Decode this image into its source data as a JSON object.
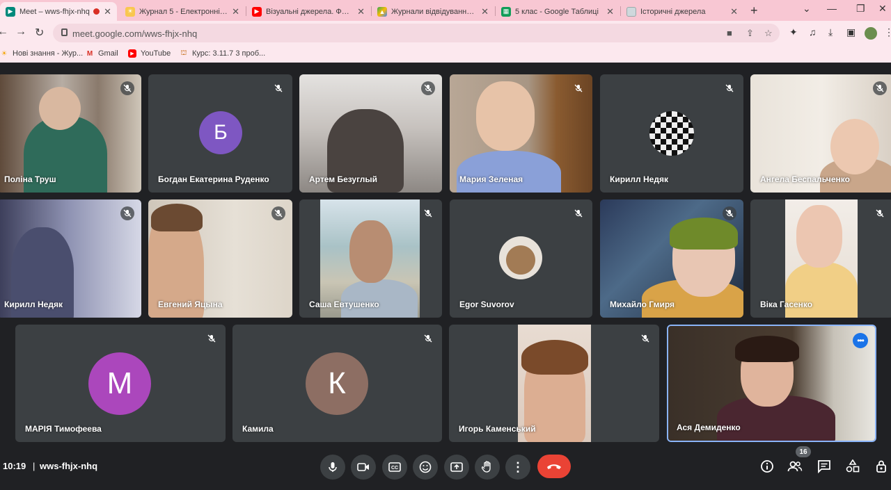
{
  "browser": {
    "tabs": [
      {
        "title": "Meet – wws-fhjx-nhq",
        "active": true
      },
      {
        "title": "Журнал 5 - Електронні щ"
      },
      {
        "title": "Візуальні джерела. Фото-"
      },
      {
        "title": "Журнали відвідування – С"
      },
      {
        "title": "5 клас - Google Таблиці"
      },
      {
        "title": "Історичні джерела"
      }
    ],
    "url": "meet.google.com/wws-fhjx-nhq",
    "bookmarks": [
      {
        "label": "Нові знання - Жур..."
      },
      {
        "label": "Gmail"
      },
      {
        "label": "YouTube"
      },
      {
        "label": "Курс: 3.11.7 3 проб..."
      }
    ]
  },
  "meet": {
    "participants": [
      {
        "name": "Поліна Труш"
      },
      {
        "name": "Богдан Екатерина Руденко",
        "initial": "Б"
      },
      {
        "name": "Артем Безуглый"
      },
      {
        "name": "Мария Зеленая"
      },
      {
        "name": "Кирилл Недяк"
      },
      {
        "name": "Ангела Беспальченко"
      },
      {
        "name": "Кирилл Недяк"
      },
      {
        "name": "Евгений Яцына"
      },
      {
        "name": "Саша Евтушенко"
      },
      {
        "name": "Egor Suvorov"
      },
      {
        "name": "Михайло Гмиря"
      },
      {
        "name": "Віка Гасенко"
      },
      {
        "name": "МАРІЯ Тимофеева",
        "initial": "М"
      },
      {
        "name": "Камила",
        "initial": "К"
      },
      {
        "name": "Игорь Каменський"
      },
      {
        "name": "Ася Демиденко"
      }
    ],
    "time": "10:19",
    "meeting_code": "wws-fhjx-nhq",
    "participant_count": "16"
  },
  "colors": {
    "accent": "#1a73e8",
    "hangup": "#ea4335",
    "tile_bg": "#3c4043",
    "avatar_purple_b": "#7e57c2",
    "avatar_purple_m": "#ab47bc",
    "avatar_brown_k": "#8d6e63"
  },
  "icons": [
    "microphone-icon",
    "camera-icon",
    "captions-icon",
    "emoji-icon",
    "present-icon",
    "raise-hand-icon",
    "more-options-icon",
    "hangup-icon",
    "info-icon",
    "people-icon",
    "chat-icon",
    "activities-icon",
    "host-controls-icon",
    "mic-off-icon"
  ]
}
